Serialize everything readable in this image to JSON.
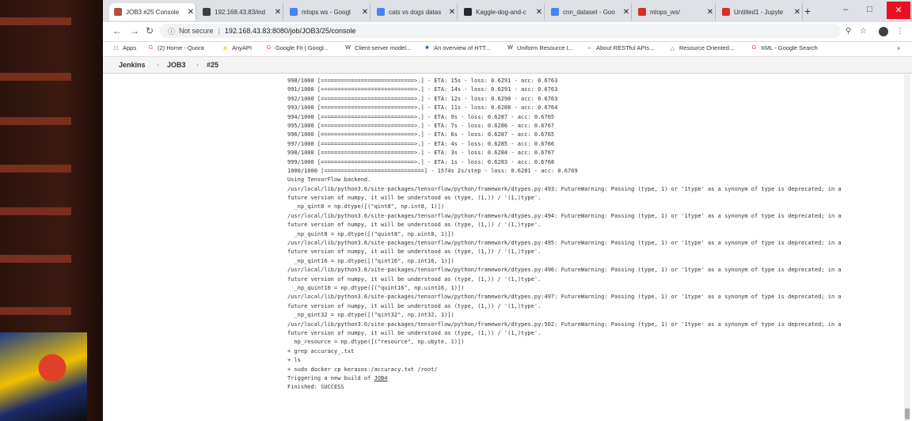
{
  "tabs": [
    {
      "title": "JOB3 #25 Console",
      "icon": "jenkins-icon",
      "color": "#b0523a",
      "active": true
    },
    {
      "title": "192.168.43.83/ind",
      "icon": "globe-icon",
      "color": "#3c4043",
      "active": false
    },
    {
      "title": "mlops ws - Googl",
      "icon": "drive-icon",
      "color": "#4285f4",
      "active": false
    },
    {
      "title": "cats vs dogs datas",
      "icon": "google-icon",
      "color": "#4285f4",
      "active": false
    },
    {
      "title": "Kaggle-dog-and-c",
      "icon": "github-icon",
      "color": "#24292e",
      "active": false
    },
    {
      "title": "cnn_dataset - Goo",
      "icon": "drive-icon",
      "color": "#4285f4",
      "active": false
    },
    {
      "title": "mlops_ws/",
      "icon": "loading-icon",
      "color": "#d93025",
      "active": false
    },
    {
      "title": "Untitled1 - Jupyte",
      "icon": "jupyter-icon",
      "color": "#d93025",
      "active": false
    }
  ],
  "address": {
    "security_label": "Not secure",
    "url": "192.168.43.83:8080/job/JOB3/25/console"
  },
  "bookmarks": [
    {
      "label": "Apps",
      "icon": "apps-grid-icon"
    },
    {
      "label": "(2) Home - Quora",
      "icon": "google-icon"
    },
    {
      "label": "AnyAPI",
      "icon": "bolt-icon"
    },
    {
      "label": "Google Fit | Googl...",
      "icon": "google-icon"
    },
    {
      "label": "Client-server model...",
      "icon": "wikipedia-icon"
    },
    {
      "label": "An overview of HTT...",
      "icon": "mdn-icon"
    },
    {
      "label": "Uniform Resource I...",
      "icon": "wikipedia-icon"
    },
    {
      "label": "About RESTful APIs...",
      "icon": "code-icon"
    },
    {
      "label": "Resource Oriented...",
      "icon": "triangle-icon"
    },
    {
      "label": "XML - Google Search",
      "icon": "google-icon"
    }
  ],
  "breadcrumb": [
    "Jenkins",
    "JOB3",
    "#25"
  ],
  "console": [
    {
      "text": "990/1000 [============================>.] - ETA: 15s - loss: 0.6291 - acc: 0.6763"
    },
    {
      "text": "991/1000 [============================>.] - ETA: 14s - loss: 0.6291 - acc: 0.6763"
    },
    {
      "text": "992/1000 [============================>.] - ETA: 12s - loss: 0.6290 - acc: 0.6763"
    },
    {
      "text": "993/1000 [============================>.] - ETA: 11s - loss: 0.6288 - acc: 0.6764"
    },
    {
      "text": "994/1000 [============================>.] - ETA: 9s - loss: 0.6287 - acc: 0.6765"
    },
    {
      "text": "995/1000 [============================>.] - ETA: 7s - loss: 0.6286 - acc: 0.6767"
    },
    {
      "text": "996/1000 [============================>.] - ETA: 6s - loss: 0.6287 - acc: 0.6765"
    },
    {
      "text": "997/1000 [============================>.] - ETA: 4s - loss: 0.6285 - acc: 0.6766"
    },
    {
      "text": "998/1000 [============================>.] - ETA: 3s - loss: 0.6284 - acc: 0.6767"
    },
    {
      "text": "999/1000 [============================>.] - ETA: 1s - loss: 0.6283 - acc: 0.6768"
    },
    {
      "text": "1000/1000 [==============================] - 1574s 2s/step - loss: 0.6281 - acc: 0.6769"
    },
    {
      "text": "Using TensorFlow backend."
    },
    {
      "text": "/usr/local/lib/python3.6/site-packages/tensorflow/python/framework/dtypes.py:493: FutureWarning: Passing (type, 1) or '1type' as a synonym of type is deprecated; in a"
    },
    {
      "text": "future version of numpy, it will be understood as (type, (1,)) / '(1,)type'."
    },
    {
      "text": "  _np_qint8 = np.dtype([(\"qint8\", np.int8, 1)])"
    },
    {
      "text": "/usr/local/lib/python3.6/site-packages/tensorflow/python/framework/dtypes.py:494: FutureWarning: Passing (type, 1) or '1type' as a synonym of type is deprecated; in a"
    },
    {
      "text": "future version of numpy, it will be understood as (type, (1,)) / '(1,)type'."
    },
    {
      "text": "  _np_quint8 = np.dtype([(\"quint8\", np.uint8, 1)])"
    },
    {
      "text": "/usr/local/lib/python3.6/site-packages/tensorflow/python/framework/dtypes.py:495: FutureWarning: Passing (type, 1) or '1type' as a synonym of type is deprecated; in a"
    },
    {
      "text": "future version of numpy, it will be understood as (type, (1,)) / '(1,)type'."
    },
    {
      "text": "  _np_qint16 = np.dtype([(\"qint16\", np.int16, 1)])"
    },
    {
      "text": "/usr/local/lib/python3.6/site-packages/tensorflow/python/framework/dtypes.py:496: FutureWarning: Passing (type, 1) or '1type' as a synonym of type is deprecated; in a"
    },
    {
      "text": "future version of numpy, it will be understood as (type, (1,)) / '(1,)type'."
    },
    {
      "text": "  _np_quint16 = np.dtype([(\"quint16\", np.uint16, 1)])"
    },
    {
      "text": "/usr/local/lib/python3.6/site-packages/tensorflow/python/framework/dtypes.py:497: FutureWarning: Passing (type, 1) or '1type' as a synonym of type is deprecated; in a"
    },
    {
      "text": "future version of numpy, it will be understood as (type, (1,)) / '(1,)type'."
    },
    {
      "text": "  _np_qint32 = np.dtype([(\"qint32\", np.int32, 1)])"
    },
    {
      "text": "/usr/local/lib/python3.6/site-packages/tensorflow/python/framework/dtypes.py:502: FutureWarning: Passing (type, 1) or '1type' as a synonym of type is deprecated; in a"
    },
    {
      "text": "future version of numpy, it will be understood as (type, (1,)) / '(1,)type'."
    },
    {
      "text": "  np_resource = np.dtype([(\"resource\", np.ubyte, 1)])"
    },
    {
      "text": "+ grep accuracy_.txt"
    },
    {
      "text": "+ ls"
    },
    {
      "text": "+ sudo docker cp kerasos:/accuracy.txt /root/"
    },
    {
      "text": "Triggering a new build of ",
      "link": "JOB4"
    },
    {
      "text": "Finished: SUCCESS"
    }
  ]
}
